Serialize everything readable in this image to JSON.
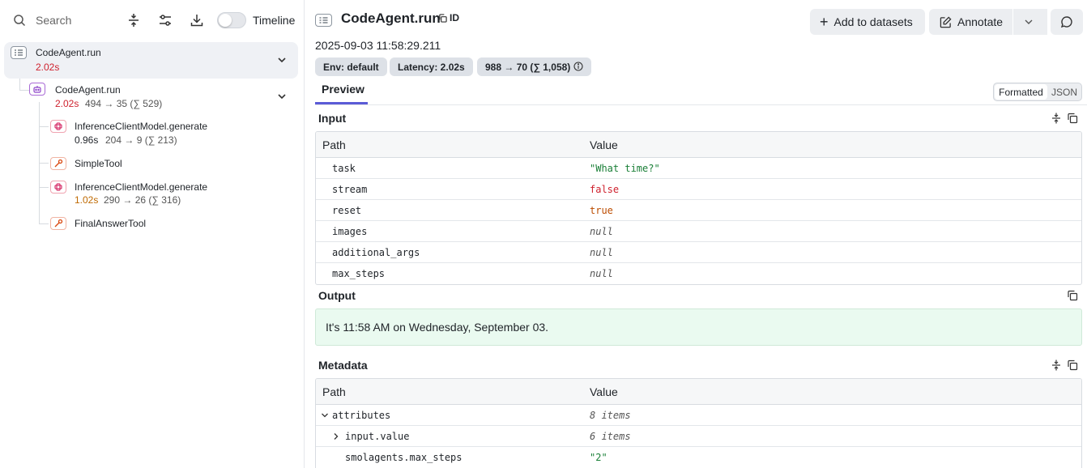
{
  "left": {
    "search_placeholder": "Search",
    "timeline_label": "Timeline",
    "tree": [
      {
        "name": "CodeAgent.run",
        "duration": "2.02s",
        "tokens": ""
      },
      {
        "name": "CodeAgent.run",
        "duration": "2.02s",
        "tokens": "494 → 35 (∑ 529)"
      },
      {
        "name": "InferenceClientModel.generate",
        "duration": "0.96s",
        "tokens": "204 → 9 (∑ 213)"
      },
      {
        "name": "SimpleTool",
        "duration": "",
        "tokens": ""
      },
      {
        "name": "InferenceClientModel.generate",
        "duration": "1.02s",
        "tokens": "290 → 26 (∑ 316)"
      },
      {
        "name": "FinalAnswerTool",
        "duration": "",
        "tokens": ""
      }
    ]
  },
  "header": {
    "title": "CodeAgent.run",
    "id_label": "ID",
    "timestamp": "2025-09-03 11:58:29.211",
    "pills": [
      "Env: default",
      "Latency: 2.02s",
      "988 → 70 (∑ 1,058)"
    ],
    "add_to_datasets_label": "Add to datasets",
    "annotate_label": "Annotate"
  },
  "tabs": {
    "preview_label": "Preview",
    "formatted_label": "Formatted",
    "json_label": "JSON"
  },
  "input": {
    "title": "Input",
    "col_path": "Path",
    "col_value": "Value",
    "rows": [
      {
        "key": "task",
        "value": "\"What time?\"",
        "kind": "str"
      },
      {
        "key": "stream",
        "value": "false",
        "kind": "false"
      },
      {
        "key": "reset",
        "value": "true",
        "kind": "true"
      },
      {
        "key": "images",
        "value": "null",
        "kind": "null"
      },
      {
        "key": "additional_args",
        "value": "null",
        "kind": "null"
      },
      {
        "key": "max_steps",
        "value": "null",
        "kind": "null"
      }
    ]
  },
  "output": {
    "title": "Output",
    "text": "It's 11:58 AM on Wednesday, September 03."
  },
  "metadata": {
    "title": "Metadata",
    "col_path": "Path",
    "col_value": "Value",
    "rows": [
      {
        "key": "attributes",
        "value": "8 items",
        "kind": "items"
      },
      {
        "key": "input.value",
        "value": "6 items",
        "kind": "items"
      },
      {
        "key": "smolagents.max_steps",
        "value": "\"2\"",
        "kind": "str"
      }
    ]
  },
  "colors": {
    "accent": "#5b5bd6",
    "duration_red": "#cf222e",
    "duration_orange": "#bf6a02",
    "output_bg": "#eafaf0"
  }
}
